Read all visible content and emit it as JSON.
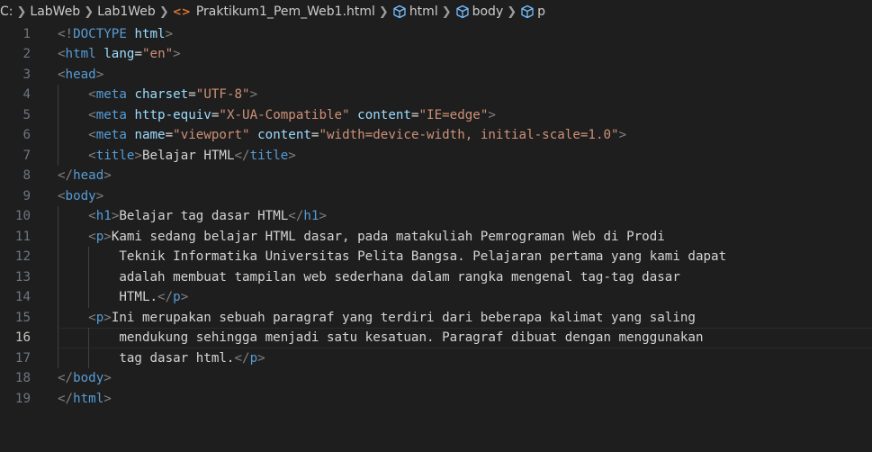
{
  "breadcrumb": {
    "drive": "C:",
    "folder1": "LabWeb",
    "folder2": "Lab1Web",
    "file_icon": "<>",
    "file": "Praktikum1_Pem_Web1.html",
    "sym1": "html",
    "sym2": "body",
    "sym3": "p"
  },
  "editor": {
    "active_line": 16,
    "colors": {
      "background": "#1e1e1e",
      "tag": "#569cd6",
      "attribute": "#9cdcfe",
      "string": "#ce9178",
      "text": "#d4d4d4",
      "bracket": "#808080",
      "line_number": "#6e7681"
    },
    "lines": [
      {
        "n": "1",
        "segments": [
          [
            "<!",
            "b"
          ],
          [
            "DOCTYPE",
            "t"
          ],
          [
            " ",
            "x"
          ],
          [
            "html",
            "a"
          ],
          [
            ">",
            "b"
          ]
        ]
      },
      {
        "n": "2",
        "segments": [
          [
            "<",
            "b"
          ],
          [
            "html",
            "t"
          ],
          [
            " ",
            "x"
          ],
          [
            "lang",
            "a"
          ],
          [
            "=",
            "x"
          ],
          [
            "\"en\"",
            "s"
          ],
          [
            ">",
            "b"
          ]
        ]
      },
      {
        "n": "3",
        "segments": [
          [
            "<",
            "b"
          ],
          [
            "head",
            "t"
          ],
          [
            ">",
            "b"
          ]
        ]
      },
      {
        "n": "4",
        "indent": 1,
        "segments": [
          [
            "    ",
            "x"
          ],
          [
            "<",
            "b"
          ],
          [
            "meta",
            "t"
          ],
          [
            " ",
            "x"
          ],
          [
            "charset",
            "a"
          ],
          [
            "=",
            "x"
          ],
          [
            "\"UTF-8\"",
            "s"
          ],
          [
            ">",
            "b"
          ]
        ]
      },
      {
        "n": "5",
        "indent": 1,
        "segments": [
          [
            "    ",
            "x"
          ],
          [
            "<",
            "b"
          ],
          [
            "meta",
            "t"
          ],
          [
            " ",
            "x"
          ],
          [
            "http-equiv",
            "a"
          ],
          [
            "=",
            "x"
          ],
          [
            "\"X-UA-Compatible\"",
            "s"
          ],
          [
            " ",
            "x"
          ],
          [
            "content",
            "a"
          ],
          [
            "=",
            "x"
          ],
          [
            "\"IE=edge\"",
            "s"
          ],
          [
            ">",
            "b"
          ]
        ]
      },
      {
        "n": "6",
        "indent": 1,
        "segments": [
          [
            "    ",
            "x"
          ],
          [
            "<",
            "b"
          ],
          [
            "meta",
            "t"
          ],
          [
            " ",
            "x"
          ],
          [
            "name",
            "a"
          ],
          [
            "=",
            "x"
          ],
          [
            "\"viewport\"",
            "s"
          ],
          [
            " ",
            "x"
          ],
          [
            "content",
            "a"
          ],
          [
            "=",
            "x"
          ],
          [
            "\"width=device-width, initial-scale=1.0\"",
            "s"
          ],
          [
            ">",
            "b"
          ]
        ]
      },
      {
        "n": "7",
        "indent": 1,
        "segments": [
          [
            "    ",
            "x"
          ],
          [
            "<",
            "b"
          ],
          [
            "title",
            "t"
          ],
          [
            ">",
            "b"
          ],
          [
            "Belajar HTML",
            "x"
          ],
          [
            "</",
            "b"
          ],
          [
            "title",
            "t"
          ],
          [
            ">",
            "b"
          ]
        ]
      },
      {
        "n": "8",
        "segments": [
          [
            "</",
            "b"
          ],
          [
            "head",
            "t"
          ],
          [
            ">",
            "b"
          ]
        ]
      },
      {
        "n": "9",
        "segments": [
          [
            "<",
            "b"
          ],
          [
            "body",
            "t"
          ],
          [
            ">",
            "b"
          ]
        ]
      },
      {
        "n": "10",
        "indent": 1,
        "segments": [
          [
            "    ",
            "x"
          ],
          [
            "<",
            "b"
          ],
          [
            "h1",
            "t"
          ],
          [
            ">",
            "b"
          ],
          [
            "Belajar tag dasar HTML",
            "x"
          ],
          [
            "</",
            "b"
          ],
          [
            "h1",
            "t"
          ],
          [
            ">",
            "b"
          ]
        ]
      },
      {
        "n": "11",
        "indent": 1,
        "segments": [
          [
            "    ",
            "x"
          ],
          [
            "<",
            "b"
          ],
          [
            "p",
            "t"
          ],
          [
            ">",
            "b"
          ],
          [
            "Kami sedang belajar HTML dasar, pada matakuliah Pemrograman Web di Prodi",
            "x"
          ]
        ]
      },
      {
        "n": "12",
        "indent": 2,
        "segments": [
          [
            "        Teknik Informatika Universitas Pelita Bangsa. Pelajaran pertama yang kami dapat",
            "x"
          ]
        ]
      },
      {
        "n": "13",
        "indent": 2,
        "segments": [
          [
            "        adalah membuat tampilan web sederhana dalam rangka mengenal tag-tag dasar",
            "x"
          ]
        ]
      },
      {
        "n": "14",
        "indent": 2,
        "segments": [
          [
            "        HTML.",
            "x"
          ],
          [
            "</",
            "b"
          ],
          [
            "p",
            "t"
          ],
          [
            ">",
            "b"
          ]
        ]
      },
      {
        "n": "15",
        "indent": 1,
        "segments": [
          [
            "    ",
            "x"
          ],
          [
            "<",
            "b"
          ],
          [
            "p",
            "t"
          ],
          [
            ">",
            "b"
          ],
          [
            "Ini merupakan sebuah paragraf yang terdiri dari beberapa kalimat yang saling",
            "x"
          ]
        ]
      },
      {
        "n": "16",
        "indent": 2,
        "segments": [
          [
            "        mendukung sehingga menjadi satu kesatuan. Paragraf dibuat dengan menggunakan",
            "x"
          ]
        ]
      },
      {
        "n": "17",
        "indent": 2,
        "segments": [
          [
            "        tag dasar html.",
            "x"
          ],
          [
            "</",
            "b"
          ],
          [
            "p",
            "t"
          ],
          [
            ">",
            "b"
          ]
        ]
      },
      {
        "n": "18",
        "segments": [
          [
            "</",
            "b"
          ],
          [
            "body",
            "t"
          ],
          [
            ">",
            "b"
          ]
        ]
      },
      {
        "n": "19",
        "segments": [
          [
            "</",
            "b"
          ],
          [
            "html",
            "t"
          ],
          [
            ">",
            "b"
          ]
        ]
      }
    ]
  }
}
